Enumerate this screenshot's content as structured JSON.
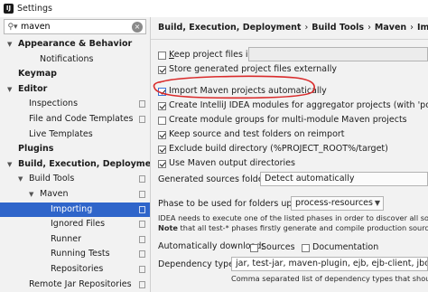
{
  "window": {
    "title": "Settings"
  },
  "search": {
    "value": "maven"
  },
  "tree": [
    {
      "label": "Appearance & Behavior",
      "bold": true,
      "arrow": "▼",
      "indent": 0,
      "cfg": false
    },
    {
      "label": "Notifications",
      "bold": false,
      "arrow": "",
      "indent": 2,
      "cfg": false
    },
    {
      "label": "Keymap",
      "bold": true,
      "arrow": "",
      "indent": 0,
      "cfg": false
    },
    {
      "label": "Editor",
      "bold": true,
      "arrow": "▼",
      "indent": 0,
      "cfg": false
    },
    {
      "label": "Inspections",
      "bold": false,
      "arrow": "",
      "indent": 1,
      "cfg": true
    },
    {
      "label": "File and Code Templates",
      "bold": false,
      "arrow": "",
      "indent": 1,
      "cfg": true
    },
    {
      "label": "Live Templates",
      "bold": false,
      "arrow": "",
      "indent": 1,
      "cfg": false
    },
    {
      "label": "Plugins",
      "bold": true,
      "arrow": "",
      "indent": 0,
      "cfg": false
    },
    {
      "label": "Build, Execution, Deployment",
      "bold": true,
      "arrow": "▼",
      "indent": 0,
      "cfg": false
    },
    {
      "label": "Build Tools",
      "bold": false,
      "arrow": "▼",
      "indent": 1,
      "cfg": true
    },
    {
      "label": "Maven",
      "bold": false,
      "arrow": "▼",
      "indent": 2,
      "cfg": true
    },
    {
      "label": "Importing",
      "bold": false,
      "arrow": "",
      "indent": 3,
      "cfg": true,
      "selected": true
    },
    {
      "label": "Ignored Files",
      "bold": false,
      "arrow": "",
      "indent": 3,
      "cfg": true
    },
    {
      "label": "Runner",
      "bold": false,
      "arrow": "",
      "indent": 3,
      "cfg": true
    },
    {
      "label": "Running Tests",
      "bold": false,
      "arrow": "",
      "indent": 3,
      "cfg": true
    },
    {
      "label": "Repositories",
      "bold": false,
      "arrow": "",
      "indent": 3,
      "cfg": true
    },
    {
      "label": "Remote Jar Repositories",
      "bold": false,
      "arrow": "",
      "indent": 1,
      "cfg": true
    }
  ],
  "breadcrumb": [
    "Build, Execution, Deployment",
    "Build Tools",
    "Maven",
    "Importing"
  ],
  "breadcrumb_sep": "›",
  "options": {
    "keep_files_in": {
      "label": "Keep project files in:",
      "checked": false
    },
    "store_external": {
      "label": "Store generated project files externally",
      "checked": true
    },
    "import_auto": {
      "label": "Import Maven projects automatically",
      "checked": true
    },
    "create_modules_agg": {
      "label": "Create IntelliJ IDEA modules for aggregator projects (with 'pom' packaging)",
      "checked": true
    },
    "module_groups": {
      "label": "Create module groups for multi-module Maven projects",
      "checked": false
    },
    "keep_folders": {
      "label": "Keep source and test folders on reimport",
      "checked": true
    },
    "exclude_build": {
      "label": "Exclude build directory (%PROJECT_ROOT%/target)",
      "checked": true
    },
    "use_output": {
      "label": "Use Maven output directories",
      "checked": true
    }
  },
  "generated_sources": {
    "label": "Generated sources folders:",
    "value": "Detect automatically"
  },
  "phase": {
    "label": "Phase to be used for folders update:",
    "value": "process-resources",
    "note1": "IDEA needs to execute one of the listed phases in order to discover all source",
    "note2_bold": "Note",
    "note2": " that all test-* phases firstly generate and compile production sources."
  },
  "auto_download": {
    "label": "Automatically download:",
    "sources": {
      "label": "Sources",
      "checked": false
    },
    "docs": {
      "label": "Documentation",
      "checked": false
    }
  },
  "dependency_types": {
    "label": "Dependency types:",
    "value": "jar, test-jar, maven-plugin, ejb, ejb-client, jboss-har, jbo",
    "note": "Comma separated list of dependency types that should be"
  },
  "colors": {
    "selection": "#2f65ca",
    "annotation": "#d92b2b",
    "accent_checkbox": "#3a73d8"
  }
}
